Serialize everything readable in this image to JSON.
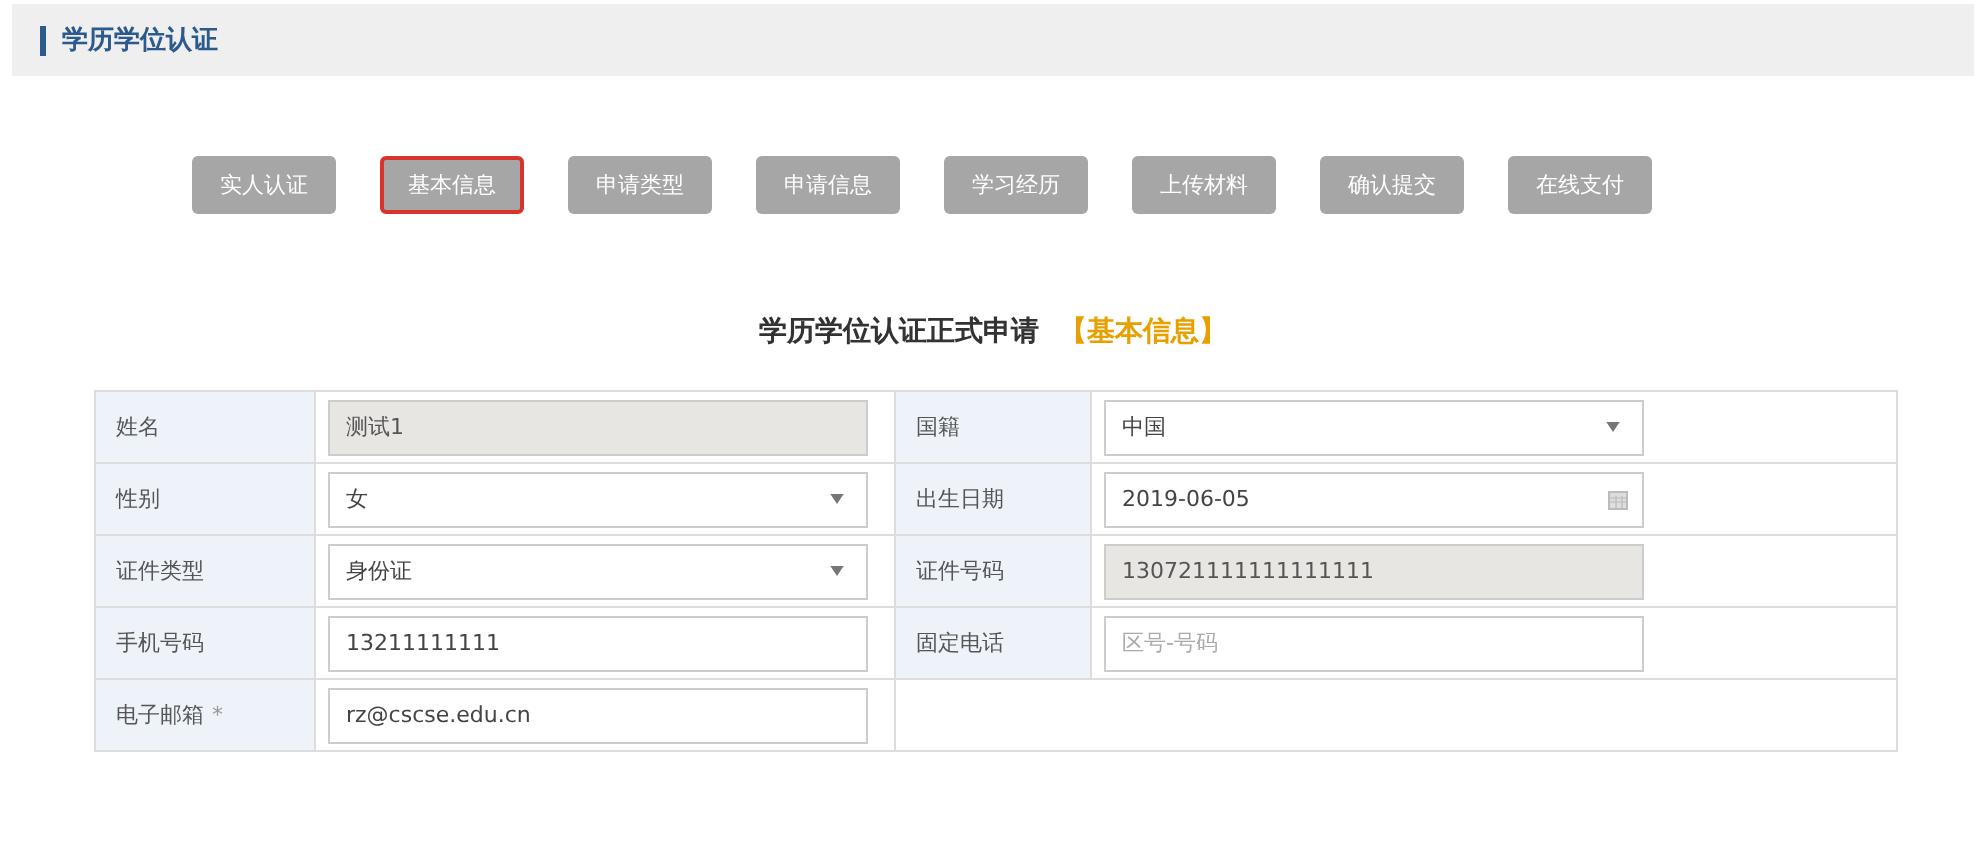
{
  "header": {
    "title": "学历学位认证"
  },
  "steps": [
    {
      "label": "实人认证",
      "selected": false
    },
    {
      "label": "基本信息",
      "selected": true
    },
    {
      "label": "申请类型",
      "selected": false
    },
    {
      "label": "申请信息",
      "selected": false
    },
    {
      "label": "学习经历",
      "selected": false
    },
    {
      "label": "上传材料",
      "selected": false
    },
    {
      "label": "确认提交",
      "selected": false
    },
    {
      "label": "在线支付",
      "selected": false
    }
  ],
  "form": {
    "title": "学历学位认证正式申请",
    "section": "【基本信息】",
    "rows": [
      {
        "fields": [
          {
            "label": "姓名",
            "kind": "text",
            "value": "测试1",
            "disabled": true
          },
          {
            "label": "国籍",
            "kind": "select",
            "value": "中国",
            "disabled": false
          }
        ]
      },
      {
        "fields": [
          {
            "label": "性别",
            "kind": "select",
            "value": "女",
            "disabled": false
          },
          {
            "label": "出生日期",
            "kind": "date",
            "value": "2019-06-05",
            "disabled": false
          }
        ]
      },
      {
        "fields": [
          {
            "label": "证件类型",
            "kind": "select",
            "value": "身份证",
            "disabled": false
          },
          {
            "label": "证件号码",
            "kind": "text",
            "value": "130721111111111111",
            "disabled": true
          }
        ]
      },
      {
        "fields": [
          {
            "label": "手机号码",
            "kind": "text",
            "value": "13211111111",
            "disabled": false
          },
          {
            "label": "固定电话",
            "kind": "text",
            "placeholder": "区号-号码",
            "disabled": false
          }
        ]
      },
      {
        "fields": [
          {
            "label": "电子邮箱",
            "required_mark": "*",
            "kind": "text",
            "value": "rz@cscse.edu.cn",
            "disabled": false
          }
        ]
      }
    ]
  }
}
